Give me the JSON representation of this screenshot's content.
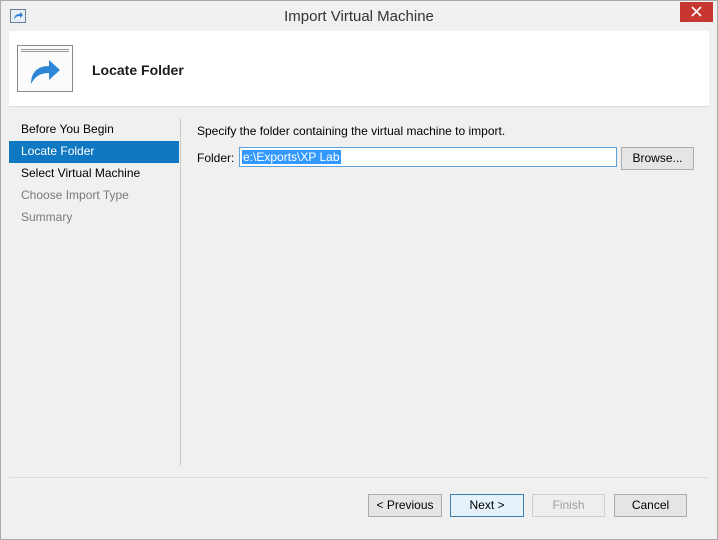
{
  "window": {
    "title": "Import Virtual Machine",
    "close_icon": "close-icon",
    "app_icon": "import-arrow-icon"
  },
  "header": {
    "icon": "wizard-import-icon",
    "title": "Locate Folder"
  },
  "nav": {
    "items": [
      {
        "label": "Before You Begin",
        "state": "normal"
      },
      {
        "label": "Locate Folder",
        "state": "active"
      },
      {
        "label": "Select Virtual Machine",
        "state": "normal"
      },
      {
        "label": "Choose Import Type",
        "state": "disabled"
      },
      {
        "label": "Summary",
        "state": "disabled"
      }
    ]
  },
  "main": {
    "description": "Specify the folder containing the virtual machine to import.",
    "folder_label": "Folder:",
    "folder_value": "e:\\Exports\\XP Lab",
    "browse_label": "Browse..."
  },
  "footer": {
    "previous_label": "< Previous",
    "next_label": "Next >",
    "finish_label": "Finish",
    "cancel_label": "Cancel"
  },
  "colors": {
    "accent": "#0f78c2",
    "close": "#c7372f",
    "selection": "#3399ff"
  }
}
